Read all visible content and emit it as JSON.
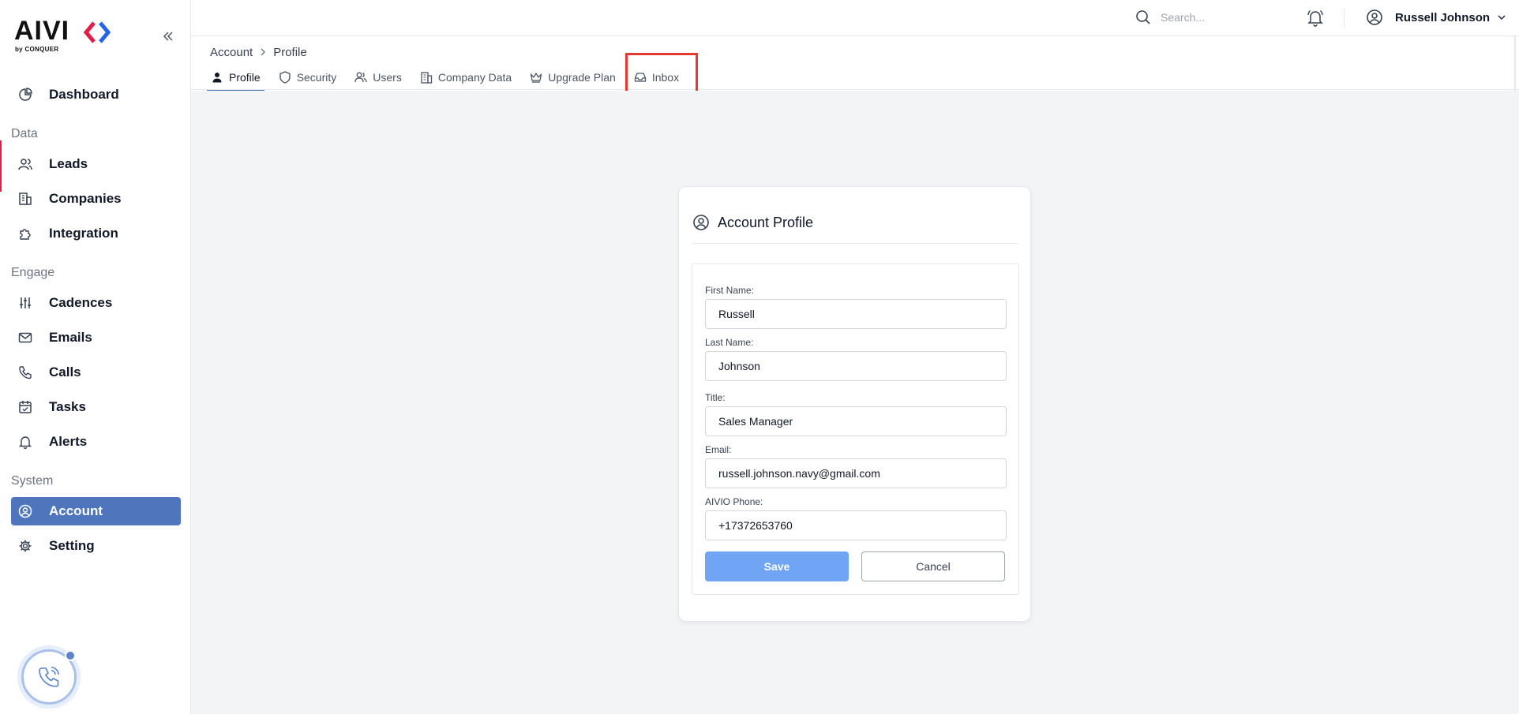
{
  "brand": {
    "name": "AIVI",
    "sub": "by CONQUER"
  },
  "sidebar": {
    "sections": {
      "data": "Data",
      "engage": "Engage",
      "system": "System"
    },
    "items": {
      "dashboard": "Dashboard",
      "leads": "Leads",
      "companies": "Companies",
      "integration": "Integration",
      "cadences": "Cadences",
      "emails": "Emails",
      "calls": "Calls",
      "tasks": "Tasks",
      "alerts": "Alerts",
      "account": "Account",
      "setting": "Setting"
    },
    "active_item": "Account"
  },
  "header": {
    "search_placeholder": "Search...",
    "user_name": "Russell Johnson"
  },
  "breadcrumb": {
    "parent": "Account",
    "current": "Profile"
  },
  "tabs": {
    "profile": "Profile",
    "security": "Security",
    "users": "Users",
    "company_data": "Company Data",
    "upgrade_plan": "Upgrade Plan",
    "inbox": "Inbox",
    "active": "Profile",
    "highlighted": "Inbox"
  },
  "profile_card": {
    "title": "Account Profile",
    "fields": {
      "first_name": {
        "label": "First Name:",
        "value": "Russell"
      },
      "last_name": {
        "label": "Last Name:",
        "value": "Johnson"
      },
      "title": {
        "label": "Title:",
        "value": "Sales Manager"
      },
      "email": {
        "label": "Email:",
        "value": "russell.johnson.navy@gmail.com"
      },
      "phone": {
        "label": "AIVIO Phone:",
        "value": "+17372653760"
      }
    },
    "save_label": "Save",
    "cancel_label": "Cancel"
  },
  "colors": {
    "accent": "#4f76bd",
    "save_button": "#6fa5f4",
    "highlight": "#e53935",
    "main_bg": "#f3f4f6"
  }
}
